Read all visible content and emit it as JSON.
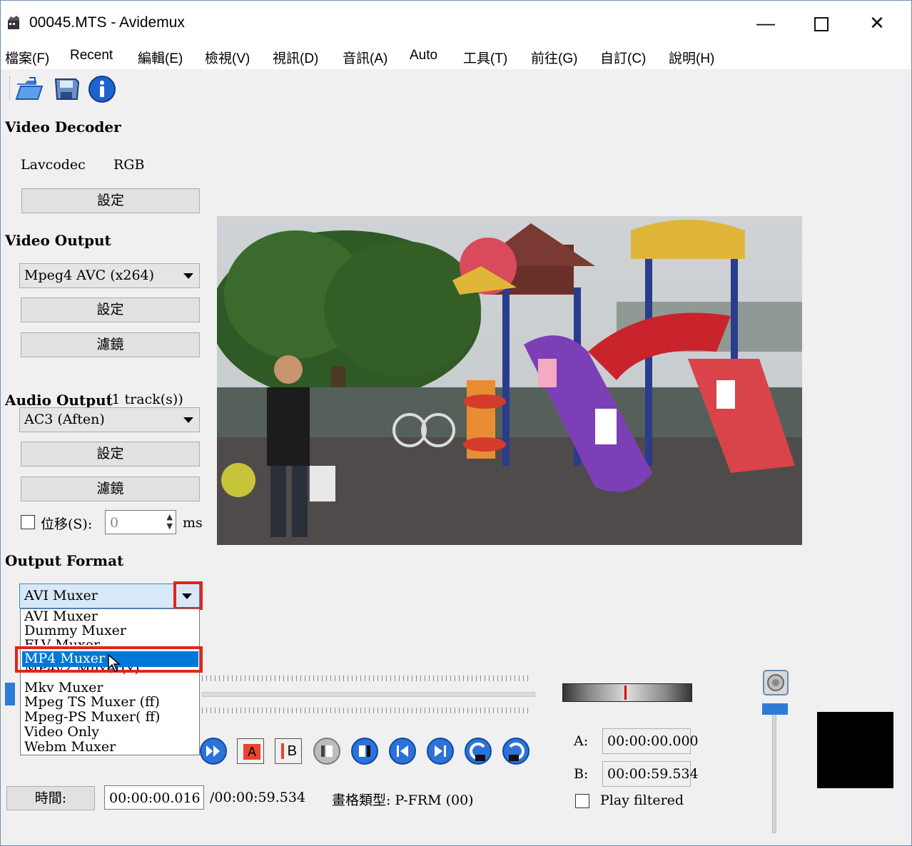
{
  "window": {
    "title": "00045.MTS - Avidemux"
  },
  "menu": [
    "檔案(F)",
    "Recent",
    "編輯(E)",
    "檢視(V)",
    "視訊(D)",
    "音訊(A)",
    "Auto",
    "工具(T)",
    "前往(G)",
    "自訂(C)",
    "說明(H)"
  ],
  "video_decoder": {
    "heading": "Video Decoder",
    "codec": "Lavcodec",
    "color": "RGB",
    "settings_label": "設定"
  },
  "video_output": {
    "heading": "Video Output",
    "codec": "Mpeg4 AVC (x264)",
    "settings_label": "設定",
    "filters_label": "濾鏡"
  },
  "audio_output": {
    "heading": "Audio Output",
    "tracks": "(1 track(s))",
    "codec": "AC3 (Aften)",
    "settings_label": "設定",
    "filters_label": "濾鏡",
    "shift_label": "位移(S):",
    "shift_value": "0",
    "shift_unit": "ms"
  },
  "output_format": {
    "heading": "Output Format",
    "selected": "AVI Muxer",
    "options": [
      "AVI Muxer",
      "Dummy Muxer",
      "FLV Muxer",
      "MP4 Muxer",
      "MP4v2 Muxer(x)",
      "Mkv Muxer",
      "Mpeg TS Muxer (ff)",
      "Mpeg-PS Muxer( ff)",
      "Video Only",
      "Webm Muxer"
    ],
    "highlighted": "MP4 Muxer"
  },
  "markers": {
    "a_label": "A:",
    "a_value": "00:00:00.000",
    "b_label": "B:",
    "b_value": "00:00:59.534",
    "play_filtered": "Play filtered"
  },
  "status": {
    "time_button": "時間:",
    "current_time": "00:00:00.016",
    "total_time": "/00:00:59.534",
    "frame_type": "畫格類型: P-FRM (00)"
  },
  "controls": {
    "a_marker_label": "A",
    "b_marker_label": "B"
  },
  "colors": {
    "accent": "#0078d7",
    "highlight_red": "#e0261c",
    "selection": "#0078d7"
  }
}
